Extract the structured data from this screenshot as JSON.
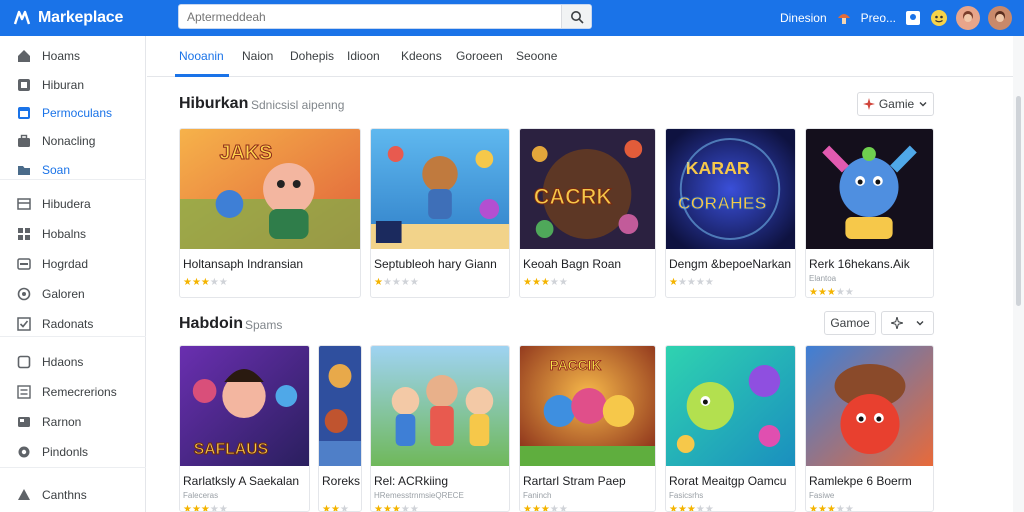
{
  "app": {
    "brand": "Markeplace",
    "search_placeholder": "Aptermeddeah",
    "top_links": [
      "Dinesion",
      "Preo..."
    ]
  },
  "sidebar": {
    "items": [
      {
        "label": "Hoams",
        "icon": "home-icon"
      },
      {
        "label": "Hiburan",
        "icon": "grid-icon"
      },
      {
        "label": "Permoculans",
        "icon": "window-icon",
        "active": true
      },
      {
        "label": "Nonacling",
        "icon": "briefcase-icon"
      },
      {
        "label": "Soan",
        "icon": "folder-icon"
      },
      {
        "label": "Hibudera",
        "icon": "layout-icon"
      },
      {
        "label": "Hobalns",
        "icon": "puzzle-icon"
      },
      {
        "label": "Hogrdad",
        "icon": "card-icon"
      },
      {
        "label": "Galoren",
        "icon": "circle-icon"
      },
      {
        "label": "Radonats",
        "icon": "check-square-icon"
      },
      {
        "label": "Hdaons",
        "icon": "square-icon"
      },
      {
        "label": "Remecrerions",
        "icon": "list-icon"
      },
      {
        "label": "Rarnon",
        "icon": "tag-icon"
      },
      {
        "label": "Pindonls",
        "icon": "location-icon"
      },
      {
        "label": "Canthns",
        "icon": "flag-icon"
      }
    ]
  },
  "tabs": [
    "Nooanin",
    "Naion",
    "Dohepis",
    "Idioon",
    "Kdeons",
    "Goroeen",
    "Seoone"
  ],
  "sections": [
    {
      "title": "Hiburkan",
      "subtitle": "Sdnicsisl aipenng",
      "chip_label": "Gamie",
      "cards": [
        {
          "title": "Holtansaph Indransian",
          "sub": "",
          "stars": 3
        },
        {
          "title": "Septubleoh hary Giann",
          "sub": "",
          "stars": 1
        },
        {
          "title": "Keoah Bagn Roan",
          "sub": "",
          "stars": 3
        },
        {
          "title": "Dengm &bepoeNarkan",
          "sub": "",
          "stars": 1
        },
        {
          "title": "Rerk 16hekans.Aik",
          "sub": "Elantoa",
          "stars": 3
        }
      ]
    },
    {
      "title": "Habdoin",
      "subtitle": "Spams",
      "chip_label": "Gamoe",
      "cards": [
        {
          "title": "Rarlatksly A Saekalan",
          "sub": "Faleceras",
          "stars": 3
        },
        {
          "title": "Roreks",
          "sub": "",
          "stars": 2
        },
        {
          "title": "Rel: ACRkiing",
          "sub": "HRemesstrnmsieQRECE",
          "stars": 3
        },
        {
          "title": "Rartarl Stram Paep",
          "sub": "Faninch",
          "stars": 3
        },
        {
          "title": "Rorat Meaitgp Oamcu",
          "sub": "Fasicsrhs",
          "stars": 3
        },
        {
          "title": "Ramlekpe 6 Boerm",
          "sub": "Fasiwe",
          "stars": 3
        }
      ]
    }
  ],
  "colors": {
    "accent": "#1a73e8",
    "star": "#f4b400"
  }
}
